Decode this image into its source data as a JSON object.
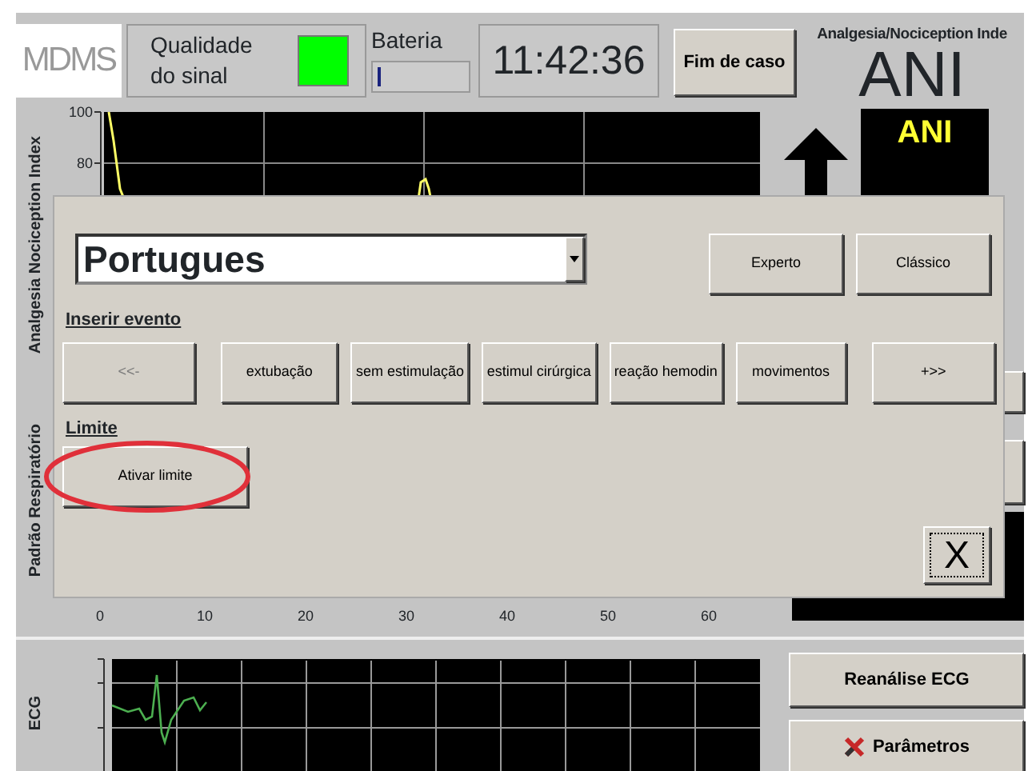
{
  "header": {
    "logo": "MDMS",
    "signal_label": "Qualidade do sinal",
    "battery": {
      "label": "Bateria",
      "level": 0.04
    },
    "clock": "11:42:36",
    "end_button": "Fim de caso",
    "ani_title": "Analgesia/Nociception Inde",
    "ani_big": "ANI"
  },
  "ani_chart": {
    "axis_label": "Analgesia Nociception Index",
    "y_ticks": [
      "100",
      "80"
    ]
  },
  "ani_display": {
    "label": "ANI"
  },
  "resp_chart": {
    "axis_label": "Padrão Respiratório",
    "x_ticks": [
      "0",
      "10",
      "20",
      "30",
      "40",
      "50",
      "60"
    ]
  },
  "ecg": {
    "axis_label": "ECG",
    "buttons": [
      "Reanálise ECG",
      "Parâmetros"
    ]
  },
  "dialog": {
    "language": "Portugues",
    "mode_buttons": [
      "Experto",
      "Clássico"
    ],
    "event_heading": "Inserir evento",
    "events": [
      {
        "label": "<<-",
        "disabled": true
      },
      {
        "label": "extubação",
        "disabled": false
      },
      {
        "label": "sem estimulação",
        "disabled": false
      },
      {
        "label": "estimul cirúrgica",
        "disabled": false
      },
      {
        "label": "reação hemodin",
        "disabled": false
      },
      {
        "label": "movimentos",
        "disabled": false
      },
      {
        "label": "+>>",
        "disabled": false
      }
    ],
    "limit_heading": "Limite",
    "limit_button": "Ativar limite",
    "close": "X"
  }
}
